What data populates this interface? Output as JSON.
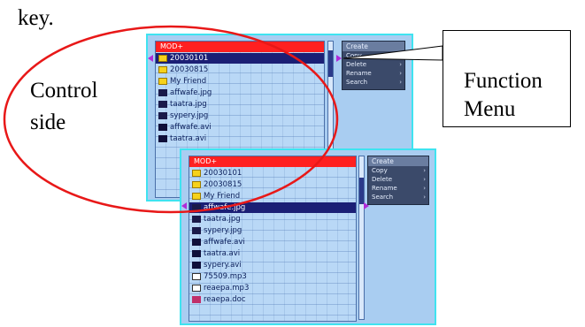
{
  "top_text": "key.",
  "control_label_line1": "Control",
  "control_label_line2": "side",
  "callout_line1": "Function",
  "callout_line2": "Menu",
  "screen1": {
    "header": "MOD+",
    "rows": [
      {
        "label": "20030101",
        "icon": "folder"
      },
      {
        "label": "20030815",
        "icon": "folder"
      },
      {
        "label": "My Friend",
        "icon": "folder"
      },
      {
        "label": "affwafe.jpg",
        "icon": "image"
      },
      {
        "label": "taatra.jpg",
        "icon": "image"
      },
      {
        "label": "sypery.jpg",
        "icon": "image"
      },
      {
        "label": "affwafe.avi",
        "icon": "video"
      },
      {
        "label": "taatra.avi",
        "icon": "video"
      }
    ],
    "menu": {
      "title": "Create",
      "items": [
        "Copy",
        "Delete",
        "Rename",
        "Search"
      ]
    }
  },
  "screen2": {
    "header": "MOD+",
    "rows": [
      {
        "label": "20030101",
        "icon": "folder"
      },
      {
        "label": "20030815",
        "icon": "folder"
      },
      {
        "label": "My Friend",
        "icon": "folder"
      },
      {
        "label": "affwafe.jpg",
        "icon": "image"
      },
      {
        "label": "taatra.jpg",
        "icon": "image"
      },
      {
        "label": "sypery.jpg",
        "icon": "image"
      },
      {
        "label": "affwafe.avi",
        "icon": "video"
      },
      {
        "label": "taatra.avi",
        "icon": "video"
      },
      {
        "label": "sypery.avi",
        "icon": "video"
      },
      {
        "label": "75509.mp3",
        "icon": "music"
      },
      {
        "label": "reaepa.mp3",
        "icon": "music"
      },
      {
        "label": "reaepa.doc",
        "icon": "document"
      }
    ],
    "menu": {
      "title": "Create",
      "items": [
        "Copy",
        "Delete",
        "Rename",
        "Search"
      ]
    }
  },
  "colors": {
    "ellipse": "#e81818",
    "header_bar": "#ff2020",
    "selection": "#1b1f75",
    "screen_border": "#3fe3f0"
  }
}
